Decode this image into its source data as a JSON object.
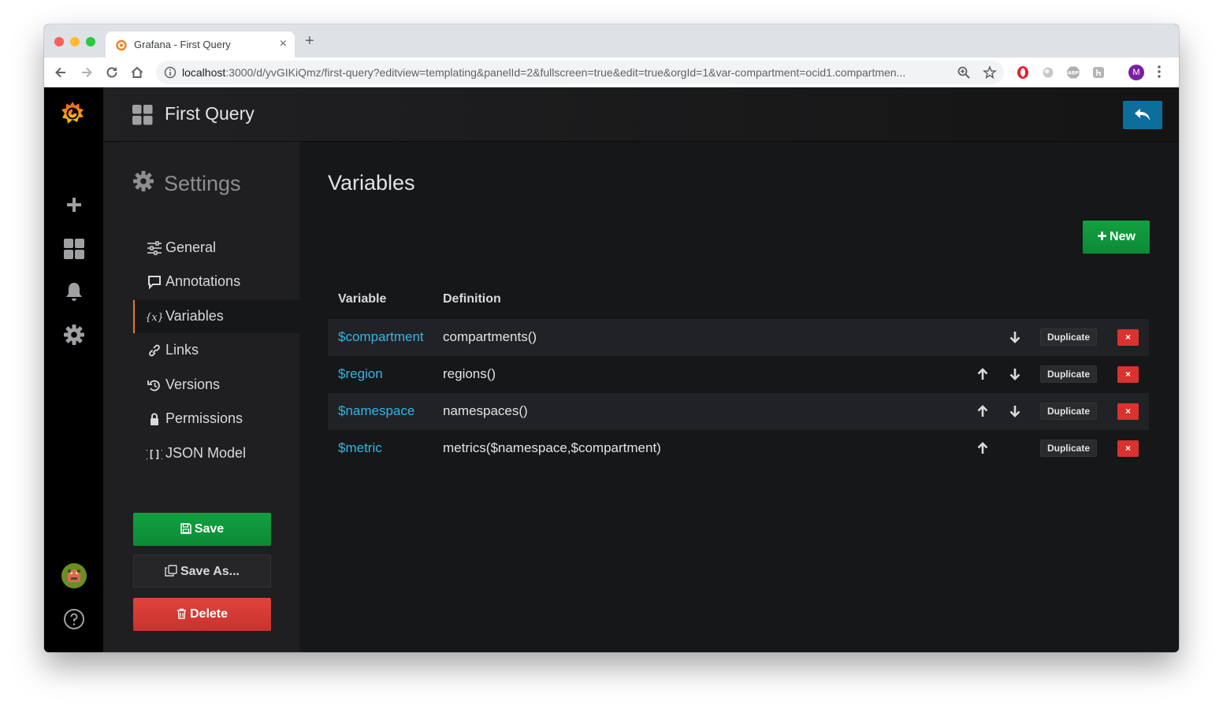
{
  "browser": {
    "tab_title": "Grafana - First Query",
    "tab_close": "×",
    "new_tab": "+",
    "url_host": "localhost",
    "url_rest": ":3000/d/yvGIKiQmz/first-query?editview=templating&panelId=2&fullscreen=true&edit=true&orgId=1&var-compartment=ocid1.compartmen...",
    "profile_initial": "M"
  },
  "header": {
    "dashboard_title": "First Query"
  },
  "settings": {
    "title": "Settings",
    "items": [
      {
        "label": "General",
        "icon": "sliders-icon"
      },
      {
        "label": "Annotations",
        "icon": "comment-icon"
      },
      {
        "label": "Variables",
        "icon": "variable-icon",
        "active": true
      },
      {
        "label": "Links",
        "icon": "link-icon"
      },
      {
        "label": "Versions",
        "icon": "history-icon"
      },
      {
        "label": "Permissions",
        "icon": "lock-icon"
      },
      {
        "label": "JSON Model",
        "icon": "json-icon"
      }
    ],
    "save_label": "Save",
    "save_as_label": "Save As...",
    "delete_label": "Delete"
  },
  "main": {
    "heading": "Variables",
    "new_label": "New",
    "columns": [
      "Variable",
      "Definition"
    ],
    "duplicate_label": "Duplicate",
    "remove_label": "×",
    "rows": [
      {
        "name": "$compartment",
        "definition": "compartments()",
        "up": false,
        "down": true
      },
      {
        "name": "$region",
        "definition": "regions()",
        "up": true,
        "down": true
      },
      {
        "name": "$namespace",
        "definition": "namespaces()",
        "up": true,
        "down": true
      },
      {
        "name": "$metric",
        "definition": "metrics($namespace,$compartment)",
        "up": true,
        "down": false
      }
    ]
  },
  "colors": {
    "accent_orange": "#eb7b18",
    "link_blue": "#33b5e5",
    "success_green": "#0b8a36",
    "danger_red": "#d9322f",
    "primary_blue": "#0d6e9e"
  }
}
